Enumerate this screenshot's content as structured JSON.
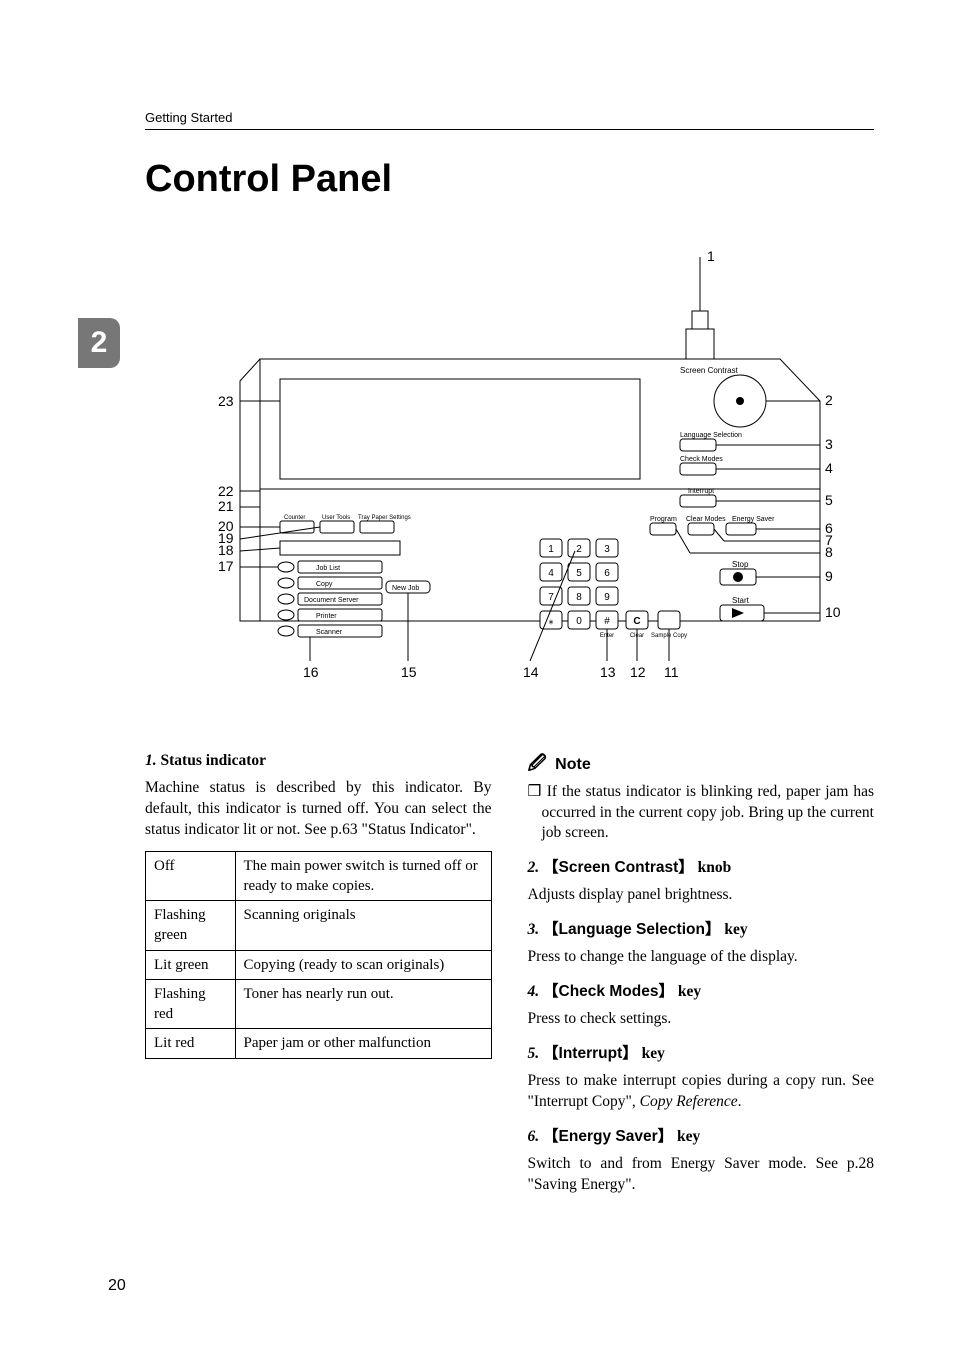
{
  "header": {
    "section": "Getting Started"
  },
  "title": "Control Panel",
  "chapter_tab": "2",
  "page_number": "20",
  "diagram": {
    "left_labels": [
      "23",
      "22",
      "21",
      "20",
      "19",
      "18",
      "17",
      "16",
      "15"
    ],
    "right_labels": [
      "1",
      "2",
      "3",
      "4",
      "5",
      "6",
      "7",
      "8",
      "9",
      "10",
      "11",
      "12",
      "13",
      "14"
    ],
    "panel_text": {
      "screen_contrast": "Screen Contrast",
      "language_selection": "Language Selection",
      "check_modes": "Check Modes",
      "interrupt": "Interrupt",
      "program": "Program",
      "clear_modes": "Clear Modes",
      "energy_saver": "Energy Saver",
      "stop": "Stop",
      "start": "Start",
      "sample_copy": "Sample Copy",
      "enter": "Enter",
      "clear": "Clear",
      "counter": "Counter",
      "user_tools": "User Tools",
      "tray": "Tray Paper Settings",
      "job_list": "Job List",
      "copy": "Copy",
      "document_server": "Document Server",
      "printer": "Printer",
      "scanner": "Scanner",
      "new_job": "New Job"
    }
  },
  "left": {
    "item1": {
      "num": "1.",
      "title": "Status indicator"
    },
    "item1_body": "Machine status is described by this indicator. By default, this indicator is turned off. You can select the status indicator lit or not. See p.63 \"Status Indicator\".",
    "table": [
      {
        "a": "Off",
        "b": "The main power switch is turned off or ready to make copies."
      },
      {
        "a": "Flashing green",
        "b": "Scanning originals"
      },
      {
        "a": "Lit green",
        "b": "Copying (ready to scan originals)"
      },
      {
        "a": "Flashing red",
        "b": "Toner has nearly run out."
      },
      {
        "a": "Lit red",
        "b": "Paper jam or other malfunction"
      }
    ]
  },
  "right": {
    "note_label": "Note",
    "note_body": "If the status indicator is blinking red, paper jam has occurred in the current copy job. Bring up the current job screen.",
    "item2": {
      "num": "2.",
      "key": "Screen Contrast",
      "suffix": "knob"
    },
    "item2_body": "Adjusts display panel brightness.",
    "item3": {
      "num": "3.",
      "key": "Language Selection",
      "suffix": "key"
    },
    "item3_body": "Press to change the language of the display.",
    "item4": {
      "num": "4.",
      "key": "Check Modes",
      "suffix": "key"
    },
    "item4_body": "Press to check settings.",
    "item5": {
      "num": "5.",
      "key": "Interrupt",
      "suffix": "key"
    },
    "item5_body_a": "Press to make interrupt copies during a copy run. See \"Interrupt Copy\", ",
    "item5_body_b": "Copy Reference",
    "item5_body_c": ".",
    "item6": {
      "num": "6.",
      "key": "Energy Saver",
      "suffix": "key"
    },
    "item6_body": "Switch to and from Energy Saver mode. See p.28 \"Saving Energy\"."
  }
}
